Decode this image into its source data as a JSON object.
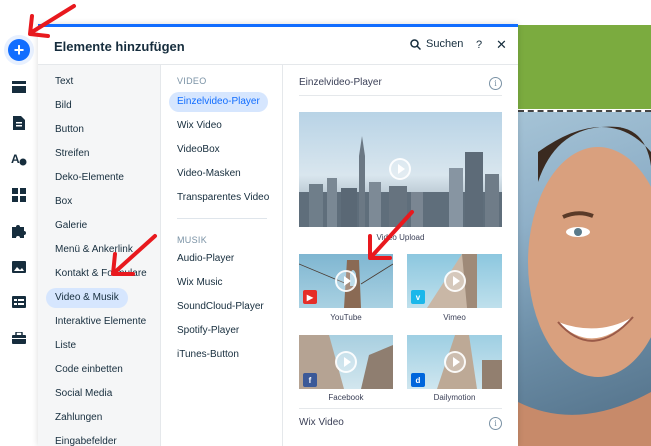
{
  "panel": {
    "title": "Elemente hinzufügen",
    "search_label": "Suchen",
    "help_label": "?",
    "close_label": "✕"
  },
  "categories": [
    {
      "label": "Text"
    },
    {
      "label": "Bild"
    },
    {
      "label": "Button"
    },
    {
      "label": "Streifen"
    },
    {
      "label": "Deko-Elemente"
    },
    {
      "label": "Box"
    },
    {
      "label": "Galerie"
    },
    {
      "label": "Menü & Ankerlink"
    },
    {
      "label": "Kontakt & Formulare"
    },
    {
      "label": "Video & Musik",
      "active": true
    },
    {
      "label": "Interaktive Elemente"
    },
    {
      "label": "Liste"
    },
    {
      "label": "Code einbetten"
    },
    {
      "label": "Social Media"
    },
    {
      "label": "Zahlungen"
    },
    {
      "label": "Eingabefelder"
    }
  ],
  "video_section": {
    "title": "VIDEO",
    "items": [
      "Einzelvideo-Player",
      "Wix Video",
      "VideoBox",
      "Video-Masken",
      "Transparentes Video"
    ]
  },
  "music_section": {
    "title": "MUSIK",
    "items": [
      "Audio-Player",
      "Wix Music",
      "SoundCloud-Player",
      "Spotify-Player",
      "iTunes-Button"
    ]
  },
  "preview": {
    "section1_title": "Einzelvideo-Player",
    "info_symbol": "i",
    "tiles": [
      {
        "label": "Video Upload"
      },
      {
        "label": "YouTube",
        "badge": "▶",
        "badge_color": "#e52d27"
      },
      {
        "label": "Vimeo",
        "badge": "v",
        "badge_color": "#1ab7ea"
      },
      {
        "label": "Facebook",
        "badge": "f",
        "badge_color": "#3b5998"
      },
      {
        "label": "Dailymotion",
        "badge": "d",
        "badge_color": "#0066dc"
      }
    ],
    "section2_title": "Wix Video"
  },
  "colors": {
    "accent": "#116dff",
    "active_bg": "#d6e6fe",
    "annotation_arrow": "#e8191e",
    "site_green": "#7bab3f"
  },
  "icons": [
    "plus-icon",
    "menu-icon",
    "page-icon",
    "theme-icon",
    "apps-icon",
    "puzzle-icon",
    "media-icon",
    "table-icon",
    "briefcase-icon",
    "search-icon",
    "info-icon",
    "play-icon"
  ]
}
